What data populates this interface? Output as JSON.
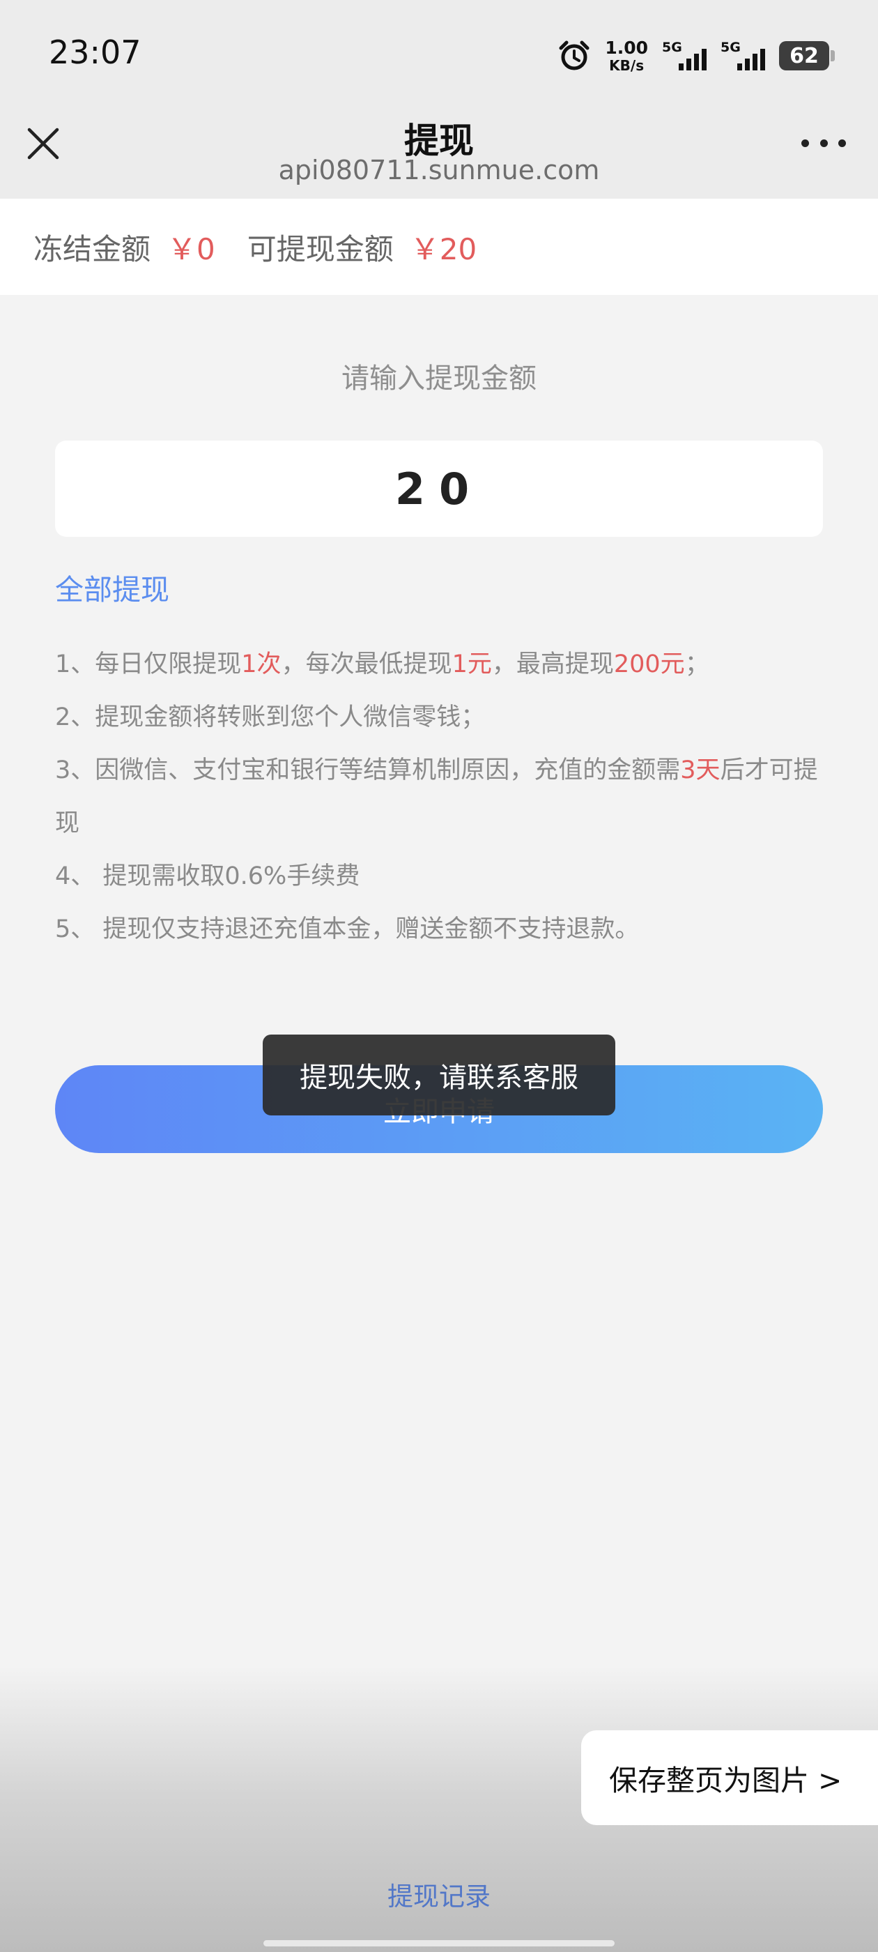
{
  "status_bar": {
    "time": "23:07",
    "net_speed_value": "1.00",
    "net_speed_unit": "KB/s",
    "sim1_label": "5G",
    "sim2_label": "5G",
    "battery": "62"
  },
  "navbar": {
    "title": "提现",
    "url": "api080711.sunmue.com"
  },
  "balance": {
    "frozen_label": "冻结金额",
    "frozen_amount": "￥0",
    "available_label": "可提现金额",
    "available_amount": "￥20"
  },
  "form": {
    "prompt": "请输入提现金额",
    "amount_value": "20",
    "withdraw_all_label": "全部提现",
    "submit_label": "立即申请"
  },
  "rules": [
    {
      "parts": [
        {
          "t": "1、每日仅限提现"
        },
        {
          "t": "1次",
          "hl": true
        },
        {
          "t": "，每次最低提现"
        },
        {
          "t": "1元",
          "hl": true
        },
        {
          "t": "，最高提现"
        },
        {
          "t": "200元",
          "hl": true
        },
        {
          "t": "；"
        }
      ]
    },
    {
      "parts": [
        {
          "t": "2、提现金额将转账到您个人微信零钱；"
        }
      ]
    },
    {
      "parts": [
        {
          "t": "3、因微信、支付宝和银行等结算机制原因，充值的金额需"
        },
        {
          "t": "3天",
          "hl": true
        },
        {
          "t": "后才可提现"
        }
      ]
    },
    {
      "parts": [
        {
          "t": "4、 提现需收取0.6%手续费"
        }
      ]
    },
    {
      "parts": [
        {
          "t": "5、 提现仅支持退还充值本金，赠送金额不支持退款。"
        }
      ]
    }
  ],
  "toast": {
    "message": "提现失败，请联系客服"
  },
  "bottom": {
    "save_page_label": "保存整页为图片 >",
    "records_label": "提现记录"
  },
  "colors": {
    "highlight": "#e25c5c",
    "link": "#5b8def",
    "button_gradient_start": "#5e86f6",
    "button_gradient_end": "#5ab3f4"
  },
  "icons": [
    "alarm-icon",
    "signal-icon",
    "battery-icon",
    "close-icon",
    "more-icon"
  ]
}
